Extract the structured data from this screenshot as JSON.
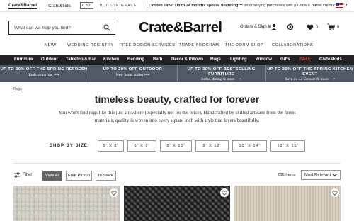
{
  "utility": {
    "brands": [
      "Crate&Barrel",
      "Crate&kids",
      "CB2",
      "HUDSON GRACE"
    ],
    "promo_bold": "Limited Time: Up to 24 months special financing***",
    "promo_rest": " on qualifying purchases with a Crate & Barrel credit card. →"
  },
  "header": {
    "search_placeholder": "What can we help you find?",
    "logo": "Crate&Barrel",
    "account": "Orders & Sign In",
    "favorites_count": "0",
    "cart_count": "0"
  },
  "subnav": [
    "NEW!",
    "WEDDING REGISTRY",
    "FREE DESIGN SERVICES",
    "TRADE PROGRAM",
    "THE DORM SHOP",
    "COLLABORATIONS"
  ],
  "categories": [
    "Furniture",
    "Outdoor",
    "Tabletop & Bar",
    "Kitchen",
    "Bedding",
    "Bath",
    "Decor & Pillows",
    "Rugs",
    "Lighting",
    "Window",
    "Gifts",
    "SALE",
    "Crate&kids"
  ],
  "promos": [
    {
      "title": "UP TO 30% OFF THE SPRING REFRESH",
      "link": "Ends tomorrow ⟶"
    },
    {
      "title": "UP TO 20% OFF OUTDOOR",
      "link": "New items added ⟶"
    },
    {
      "title": "UP TO 30% OFF BESTSELLING FURNITURE",
      "link": "Sofas, dining & more ⟶"
    },
    {
      "title": "UP TO 35% OFF THE SPRING KITCHEN EVENT",
      "link": "Save on Le Creuset & more ⟶"
    }
  ],
  "breadcrumb": "Rugs",
  "hero": {
    "heading": "timeless beauty, crafted for forever",
    "intro": "You won't find rugs like this just anywhere (especially not for the price). Handcrafted by skilled artisans from the finest materials, quality is woven into every square inch with style that layers beautifully."
  },
  "size": {
    "label": "SHOP BY SIZE:",
    "options": [
      "5' X 8'",
      "6' X 9'",
      "8' X 10'",
      "9' X 12'",
      "10' X 14'",
      "12' X 15'"
    ]
  },
  "filters": {
    "filter_label": "Filter",
    "chips": [
      "View All",
      "Free Pickup",
      "In Stock"
    ],
    "count": "206 Items",
    "sort": "Most Relevant"
  }
}
